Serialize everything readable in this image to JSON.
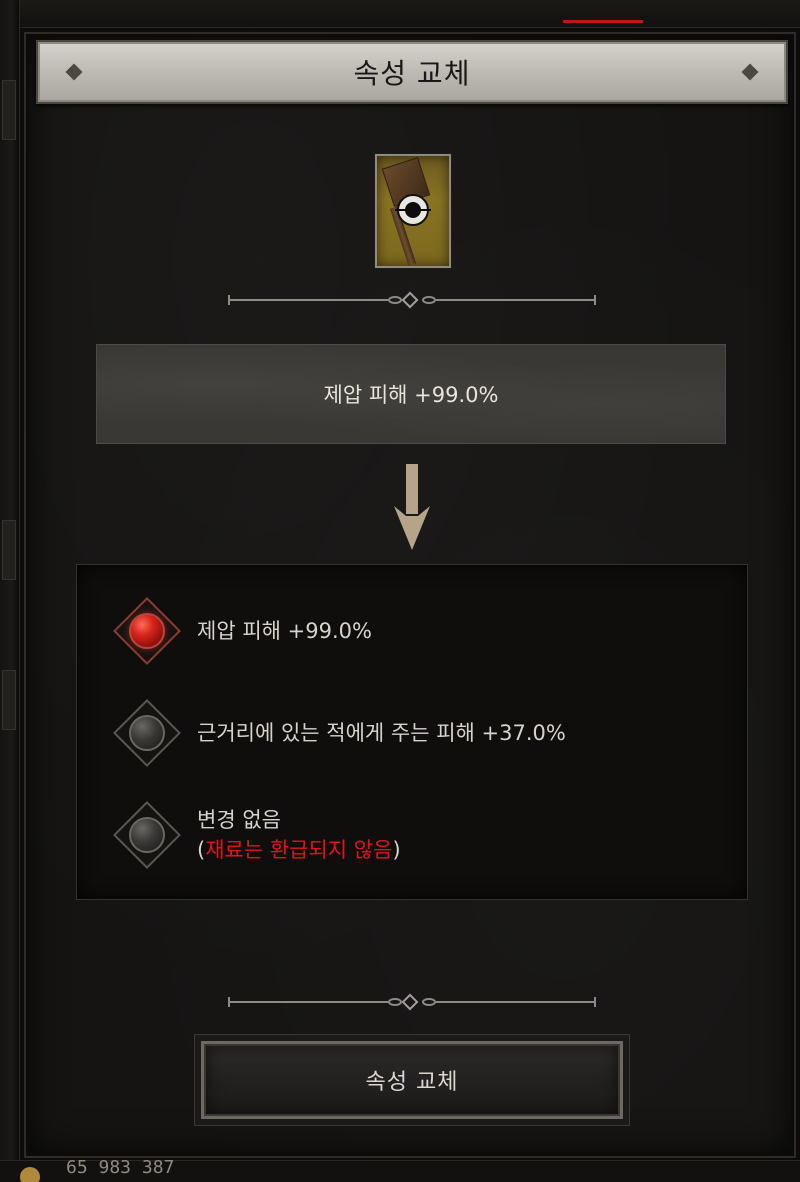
{
  "panel": {
    "title": "속성 교체"
  },
  "item": {
    "icon": "hammer-icon",
    "overlay_icon": "crosshair-icon"
  },
  "current_affix": {
    "text": "제압 피해 +99.0%"
  },
  "options": [
    {
      "text": "제압 피해 +99.0%",
      "selected": true
    },
    {
      "text": "근거리에 있는 적에게 주는 피해 +37.0%",
      "selected": false
    },
    {
      "text": "변경 없음",
      "note_open": "(",
      "note": "재료는 환급되지 않음",
      "note_close": ")",
      "selected": false
    }
  ],
  "confirm_button": {
    "label": "속성 교체"
  },
  "footer": {
    "gold_text": "65 983 387"
  },
  "colors": {
    "warning": "#e0151b",
    "selected_orb": "#d8251c"
  }
}
